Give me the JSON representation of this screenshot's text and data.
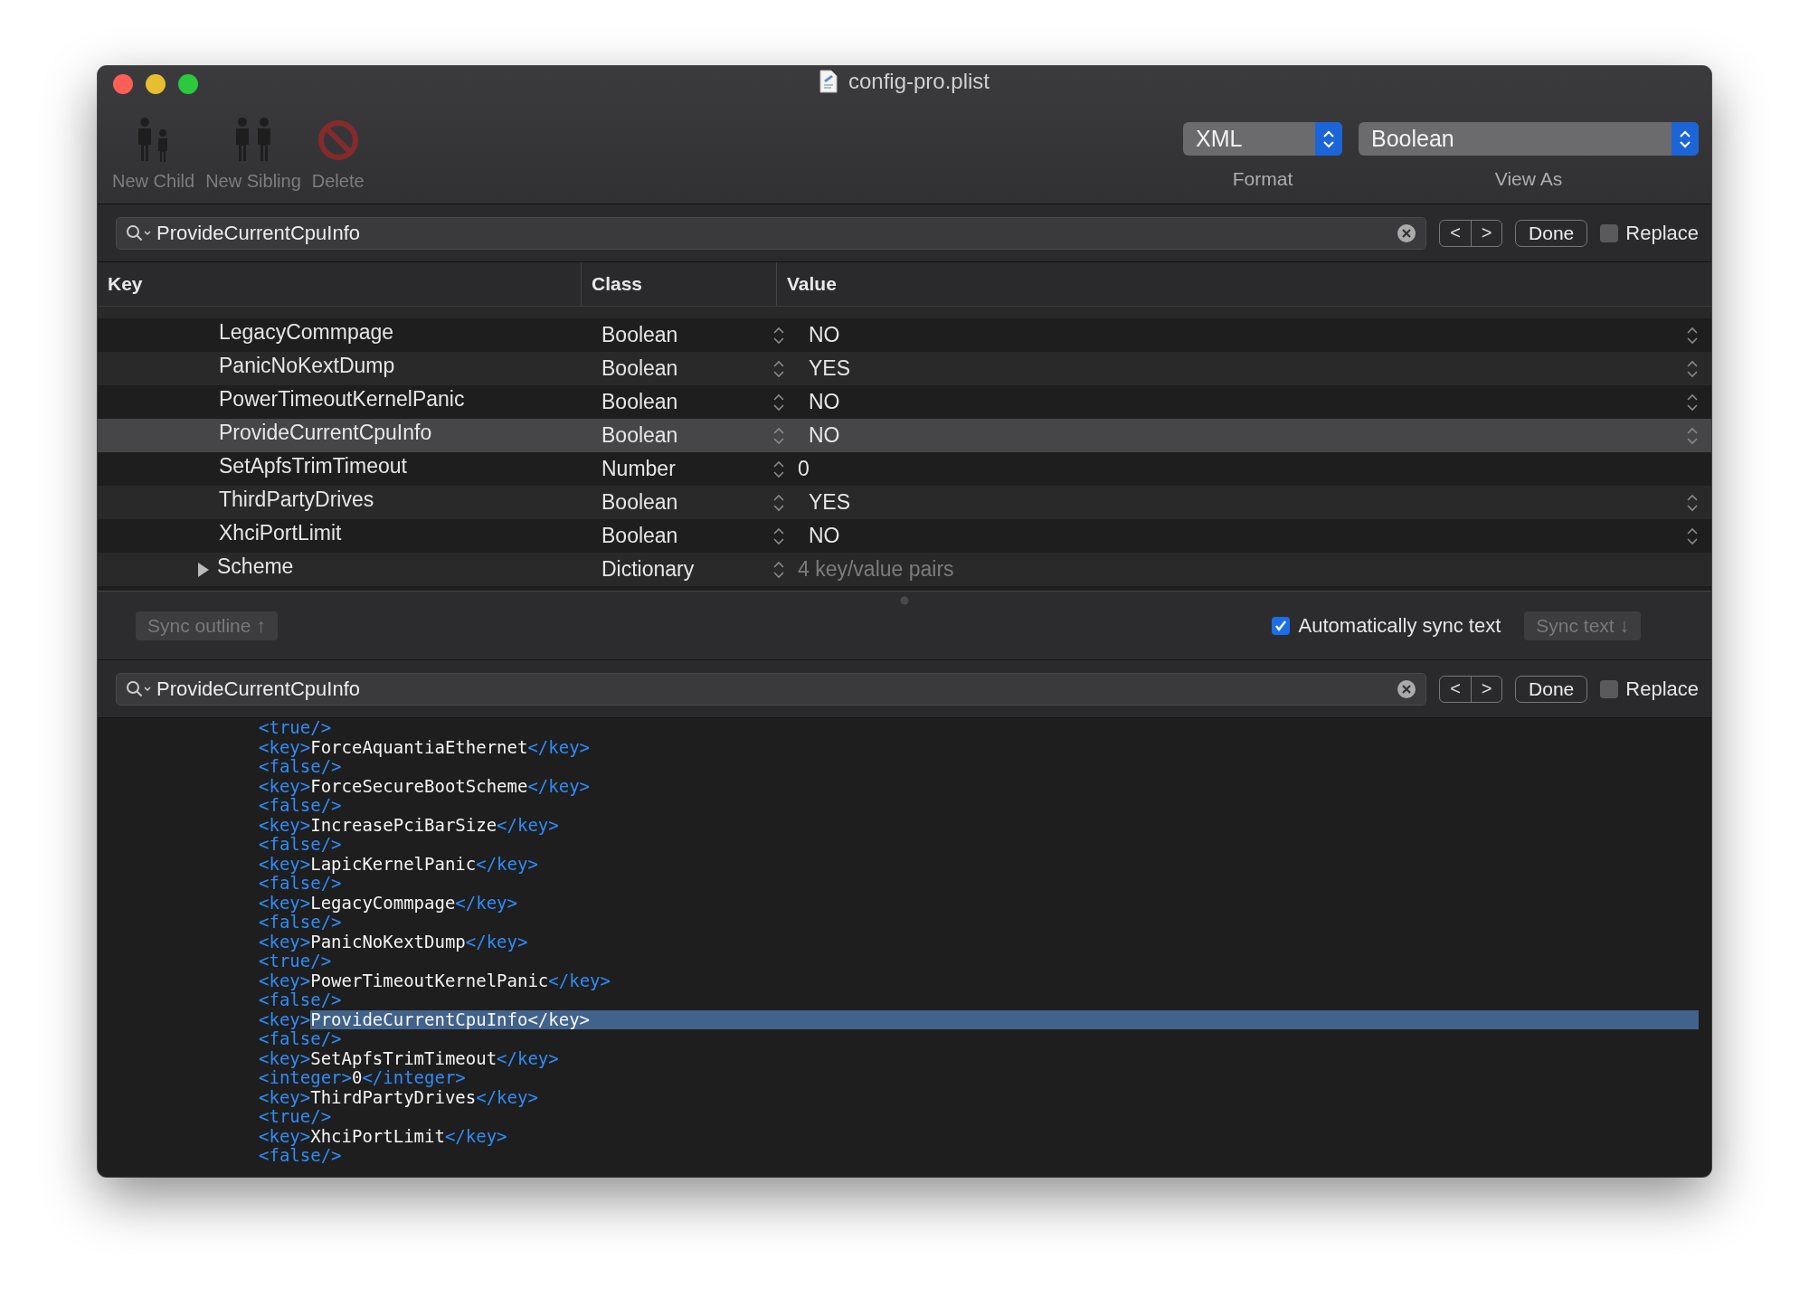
{
  "window": {
    "title": "config-pro.plist"
  },
  "toolbar": {
    "buttons": [
      {
        "label": "New Child",
        "kind": "child",
        "disabled": true
      },
      {
        "label": "New Sibling",
        "kind": "sibling",
        "disabled": true
      },
      {
        "label": "Delete",
        "kind": "delete",
        "disabled": true
      }
    ],
    "popups": [
      {
        "value": "XML",
        "label": "Format",
        "kind": "narrow"
      },
      {
        "value": "Boolean",
        "label": "View As",
        "kind": "wide"
      }
    ]
  },
  "find_top": {
    "value": "ProvideCurrentCpuInfo",
    "done": "Done",
    "prev": "<",
    "next": ">",
    "replace": {
      "label": "Replace",
      "checked": false
    }
  },
  "table": {
    "columns": [
      "Key",
      "Class",
      "Value"
    ],
    "rows": [
      {
        "key": "LegacyCommpage",
        "class": "Boolean",
        "value": "NO",
        "kind": "boolean",
        "selected": false
      },
      {
        "key": "PanicNoKextDump",
        "class": "Boolean",
        "value": "YES",
        "kind": "boolean",
        "selected": false
      },
      {
        "key": "PowerTimeoutKernelPanic",
        "class": "Boolean",
        "value": "NO",
        "kind": "boolean",
        "selected": false
      },
      {
        "key": "ProvideCurrentCpuInfo",
        "class": "Boolean",
        "value": "NO",
        "kind": "boolean",
        "selected": true
      },
      {
        "key": "SetApfsTrimTimeout",
        "class": "Number",
        "value": "0",
        "kind": "number",
        "selected": false
      },
      {
        "key": "ThirdPartyDrives",
        "class": "Boolean",
        "value": "YES",
        "kind": "boolean",
        "selected": false
      },
      {
        "key": "XhciPortLimit",
        "class": "Boolean",
        "value": "NO",
        "kind": "boolean",
        "selected": false
      },
      {
        "key": "Scheme",
        "class": "Dictionary",
        "value": "4 key/value pairs",
        "kind": "dictionary",
        "expanded": false,
        "selected": false
      }
    ]
  },
  "sync_bar": {
    "sync_outline": {
      "label": "Sync outline ↑",
      "disabled": true
    },
    "auto_sync": {
      "label": "Automatically sync text",
      "checked": true
    },
    "sync_text": {
      "label": "Sync text ↓",
      "disabled": true
    }
  },
  "find_bottom": {
    "value": "ProvideCurrentCpuInfo",
    "done": "Done",
    "prev": "<",
    "next": ">",
    "replace": {
      "label": "Replace",
      "checked": false
    }
  },
  "code_lines": [
    {
      "open": "<true/>",
      "selected": false
    },
    {
      "open": "<key>",
      "text": "ForceAquantiaEthernet",
      "close": "</key>",
      "selected": false
    },
    {
      "open": "<false/>",
      "selected": false
    },
    {
      "open": "<key>",
      "text": "ForceSecureBootScheme",
      "close": "</key>",
      "selected": false
    },
    {
      "open": "<false/>",
      "selected": false
    },
    {
      "open": "<key>",
      "text": "IncreasePciBarSize",
      "close": "</key>",
      "selected": false
    },
    {
      "open": "<false/>",
      "selected": false
    },
    {
      "open": "<key>",
      "text": "LapicKernelPanic",
      "close": "</key>",
      "selected": false
    },
    {
      "open": "<false/>",
      "selected": false
    },
    {
      "open": "<key>",
      "text": "LegacyCommpage",
      "close": "</key>",
      "selected": false
    },
    {
      "open": "<false/>",
      "selected": false
    },
    {
      "open": "<key>",
      "text": "PanicNoKextDump",
      "close": "</key>",
      "selected": false
    },
    {
      "open": "<true/>",
      "selected": false
    },
    {
      "open": "<key>",
      "text": "PowerTimeoutKernelPanic",
      "close": "</key>",
      "selected": false
    },
    {
      "open": "<false/>",
      "selected": false
    },
    {
      "open": "<key>",
      "text": "ProvideCurrentCpuInfo",
      "close": "</key>",
      "selected": true
    },
    {
      "open": "<false/>",
      "selected": false
    },
    {
      "open": "<key>",
      "text": "SetApfsTrimTimeout",
      "close": "</key>",
      "selected": false
    },
    {
      "open": "<integer>",
      "text": "0",
      "close": "</integer>",
      "selected": false
    },
    {
      "open": "<key>",
      "text": "ThirdPartyDrives",
      "close": "</key>",
      "selected": false
    },
    {
      "open": "<true/>",
      "selected": false
    },
    {
      "open": "<key>",
      "text": "XhciPortLimit",
      "close": "</key>",
      "selected": false
    },
    {
      "open": "<false/>",
      "selected": false
    }
  ]
}
